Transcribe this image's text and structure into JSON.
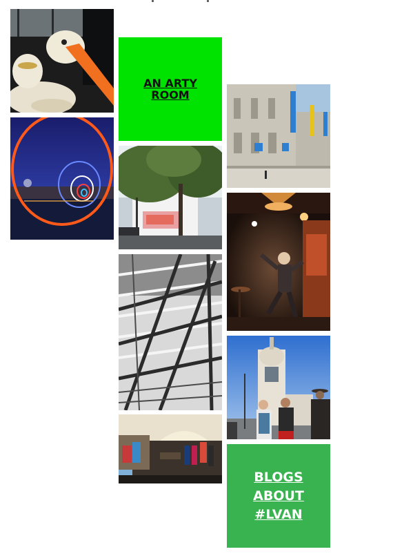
{
  "tiles": {
    "arty_room": {
      "label": "AN ARTY ROOM",
      "bg": "#00e200",
      "text_color": "#111111"
    },
    "blogs": {
      "label": "BLOGS ABOUT #LVAN",
      "bg": "#38b34f",
      "text_color": "#ffffff"
    }
  },
  "photos": [
    {
      "name": "bird-sculpture-photo"
    },
    {
      "name": "neon-rings-night-photo"
    },
    {
      "name": "street-mural-tree-photo"
    },
    {
      "name": "metal-staircase-photo"
    },
    {
      "name": "shop-interior-photo"
    },
    {
      "name": "museum-facade-photo"
    },
    {
      "name": "dancer-bar-photo"
    },
    {
      "name": "lu-tower-people-photo"
    }
  ]
}
